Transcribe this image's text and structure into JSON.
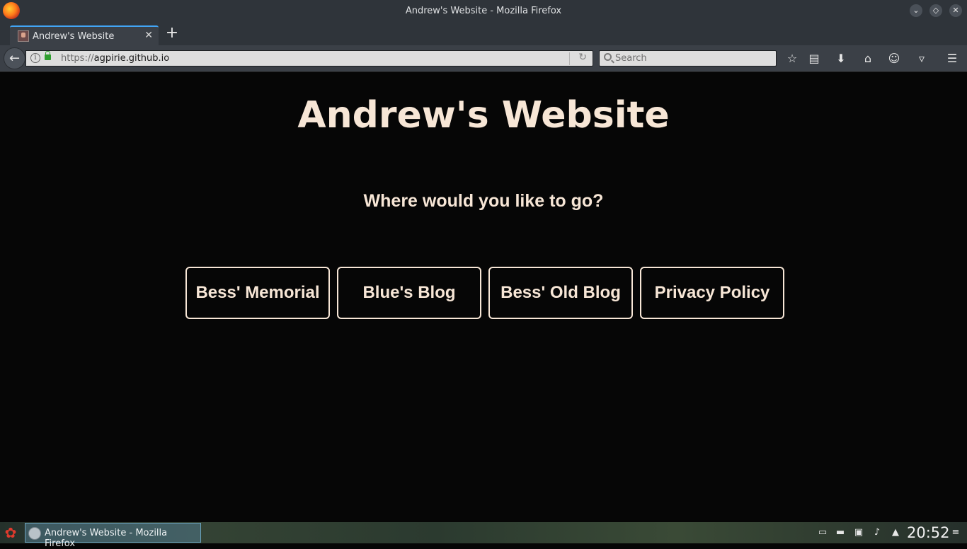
{
  "window": {
    "title": "Andrew's Website - Mozilla Firefox"
  },
  "tabs": {
    "active_label": "Andrew's Website",
    "close_glyph": "✕",
    "new_tab_glyph": "+"
  },
  "navbar": {
    "url_protocol": "https://",
    "url_host": "agpirie.github.io",
    "search_placeholder": "Search"
  },
  "page": {
    "title": "Andrew's Website",
    "prompt": "Where would you like to go?",
    "links": [
      {
        "label": "Bess' Memorial"
      },
      {
        "label": "Blue's Blog"
      },
      {
        "label": "Bess' Old Blog"
      },
      {
        "label": "Privacy Policy"
      }
    ],
    "text_color": "#f7e6d6",
    "background_color": "#060606"
  },
  "taskbar": {
    "task_label": "Andrew's Website - Mozilla Firefox",
    "clock": "20:52"
  },
  "icons": {
    "toolbar": [
      "bookmark-star-icon",
      "reading-list-icon",
      "downloads-icon",
      "home-icon",
      "emoji-icon",
      "pocket-icon",
      "hamburger-menu-icon"
    ],
    "tray": [
      "network-icon",
      "battery-icon",
      "clipboard-icon",
      "volume-icon",
      "expand-tray-icon",
      "tray-menu-icon"
    ]
  }
}
